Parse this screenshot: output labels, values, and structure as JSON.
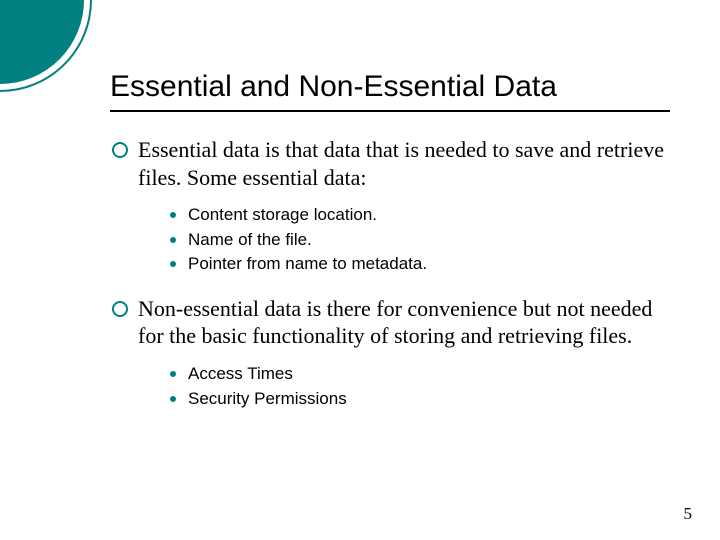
{
  "slide": {
    "title": "Essential and Non-Essential Data",
    "para1": "Essential data is that data that is needed to save and retrieve files. Some essential data:",
    "list1": {
      "item0": "Content storage location.",
      "item1": "Name of the file.",
      "item2": "Pointer from name to metadata."
    },
    "para2": "Non-essential data is there for convenience but not needed for the basic functionality of storing and retrieving files.",
    "list2": {
      "item0": "Access Times",
      "item1": "Security Permissions"
    },
    "page_number": "5"
  }
}
